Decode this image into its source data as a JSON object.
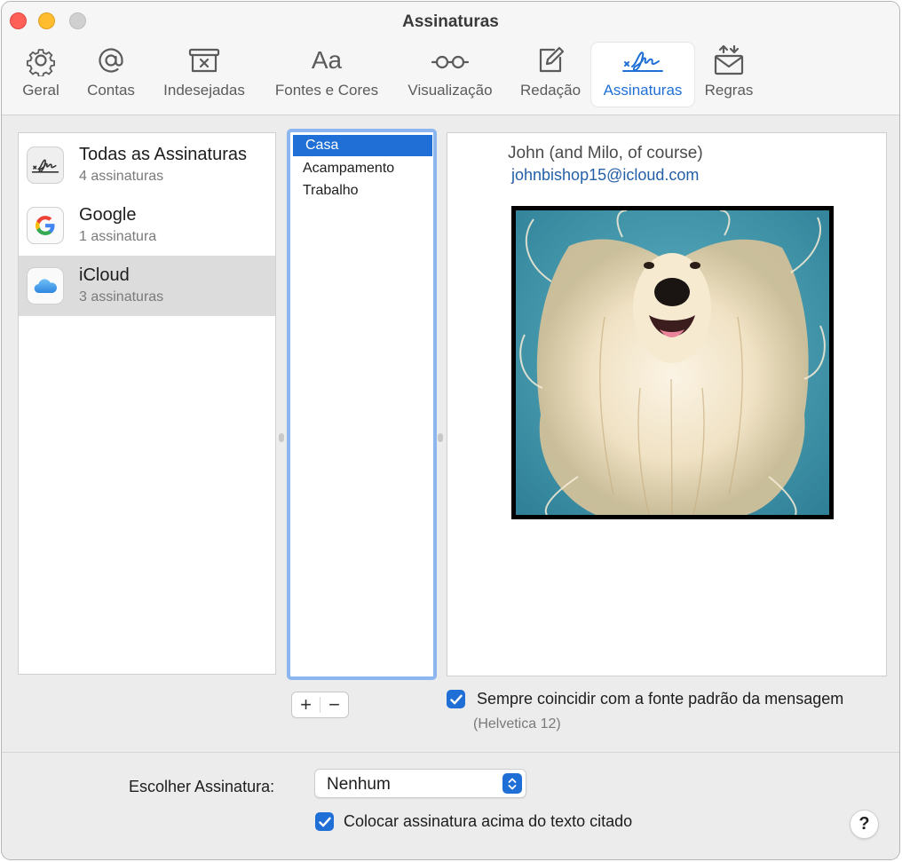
{
  "window": {
    "title": "Assinaturas"
  },
  "toolbar": {
    "tabs": [
      {
        "label": "Geral",
        "icon": "gear-icon"
      },
      {
        "label": "Contas",
        "icon": "at-sign-icon"
      },
      {
        "label": "Indesejadas",
        "icon": "junk-tray-icon"
      },
      {
        "label": "Fontes e Cores",
        "icon": "font-aa-icon"
      },
      {
        "label": "Visualização",
        "icon": "glasses-icon"
      },
      {
        "label": "Redação",
        "icon": "compose-icon"
      },
      {
        "label": "Assinaturas",
        "icon": "signature-icon"
      },
      {
        "label": "Regras",
        "icon": "rules-envelope-icon"
      }
    ],
    "active_tab": "Assinaturas"
  },
  "accounts": [
    {
      "name": "Todas as Assinaturas",
      "count": "4 assinaturas",
      "icon": "signature-icon"
    },
    {
      "name": "Google",
      "count": "1 assinatura",
      "icon": "google-icon"
    },
    {
      "name": "iCloud",
      "count": "3 assinaturas",
      "icon": "icloud-icon",
      "selected": true
    }
  ],
  "signatures": {
    "items": [
      "Casa",
      "Acampamento",
      "Trabalho"
    ],
    "selected": "Casa"
  },
  "preview": {
    "name_line": "John (and Milo, of course)",
    "email": "johnbishop15@icloud.com",
    "image": "photo of a long-haired Afghan hound with windblown fur on a teal background"
  },
  "buttons": {
    "add": "+",
    "remove": "−",
    "help": "?"
  },
  "options": {
    "match_font_label": "Sempre coincidir com a fonte padrão da mensagem",
    "match_font_checked": true,
    "font_note": "(Helvetica 12)",
    "choose_label": "Escolher Assinatura:",
    "choose_value": "Nenhum",
    "place_above_label": "Colocar assinatura acima do texto citado",
    "place_above_checked": true
  },
  "colors": {
    "accent": "#1f6fd6",
    "link": "#2460a7",
    "selection_focus": "#8db6ee"
  }
}
